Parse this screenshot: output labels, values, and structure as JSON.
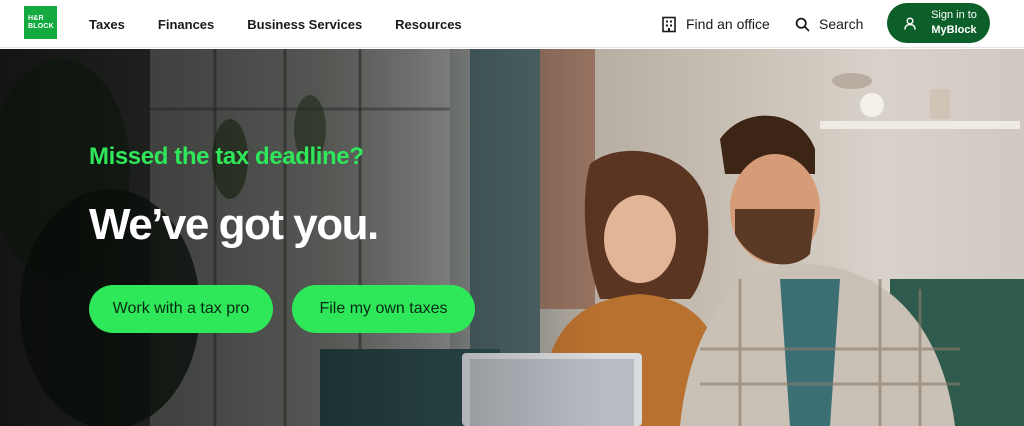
{
  "brand": {
    "logo_text": "H&R\nBLOCK",
    "accent": "#14aa40",
    "dark_green": "#0d5f2a",
    "cta_green": "#2ee85a"
  },
  "nav": {
    "items": [
      {
        "label": "Taxes"
      },
      {
        "label": "Finances"
      },
      {
        "label": "Business Services"
      },
      {
        "label": "Resources"
      }
    ]
  },
  "utility": {
    "find_office": {
      "label": "Find an office",
      "icon": "office-building-icon"
    },
    "search": {
      "label": "Search",
      "icon": "search-icon"
    },
    "signin": {
      "line1": "Sign in to",
      "line2": "MyBlock",
      "icon": "user-icon"
    }
  },
  "hero": {
    "eyebrow": "Missed the tax deadline?",
    "headline": "We’ve got you.",
    "cta_primary": "Work with a tax pro",
    "cta_secondary": "File my own taxes",
    "image": "couple-at-laptop-photo"
  }
}
